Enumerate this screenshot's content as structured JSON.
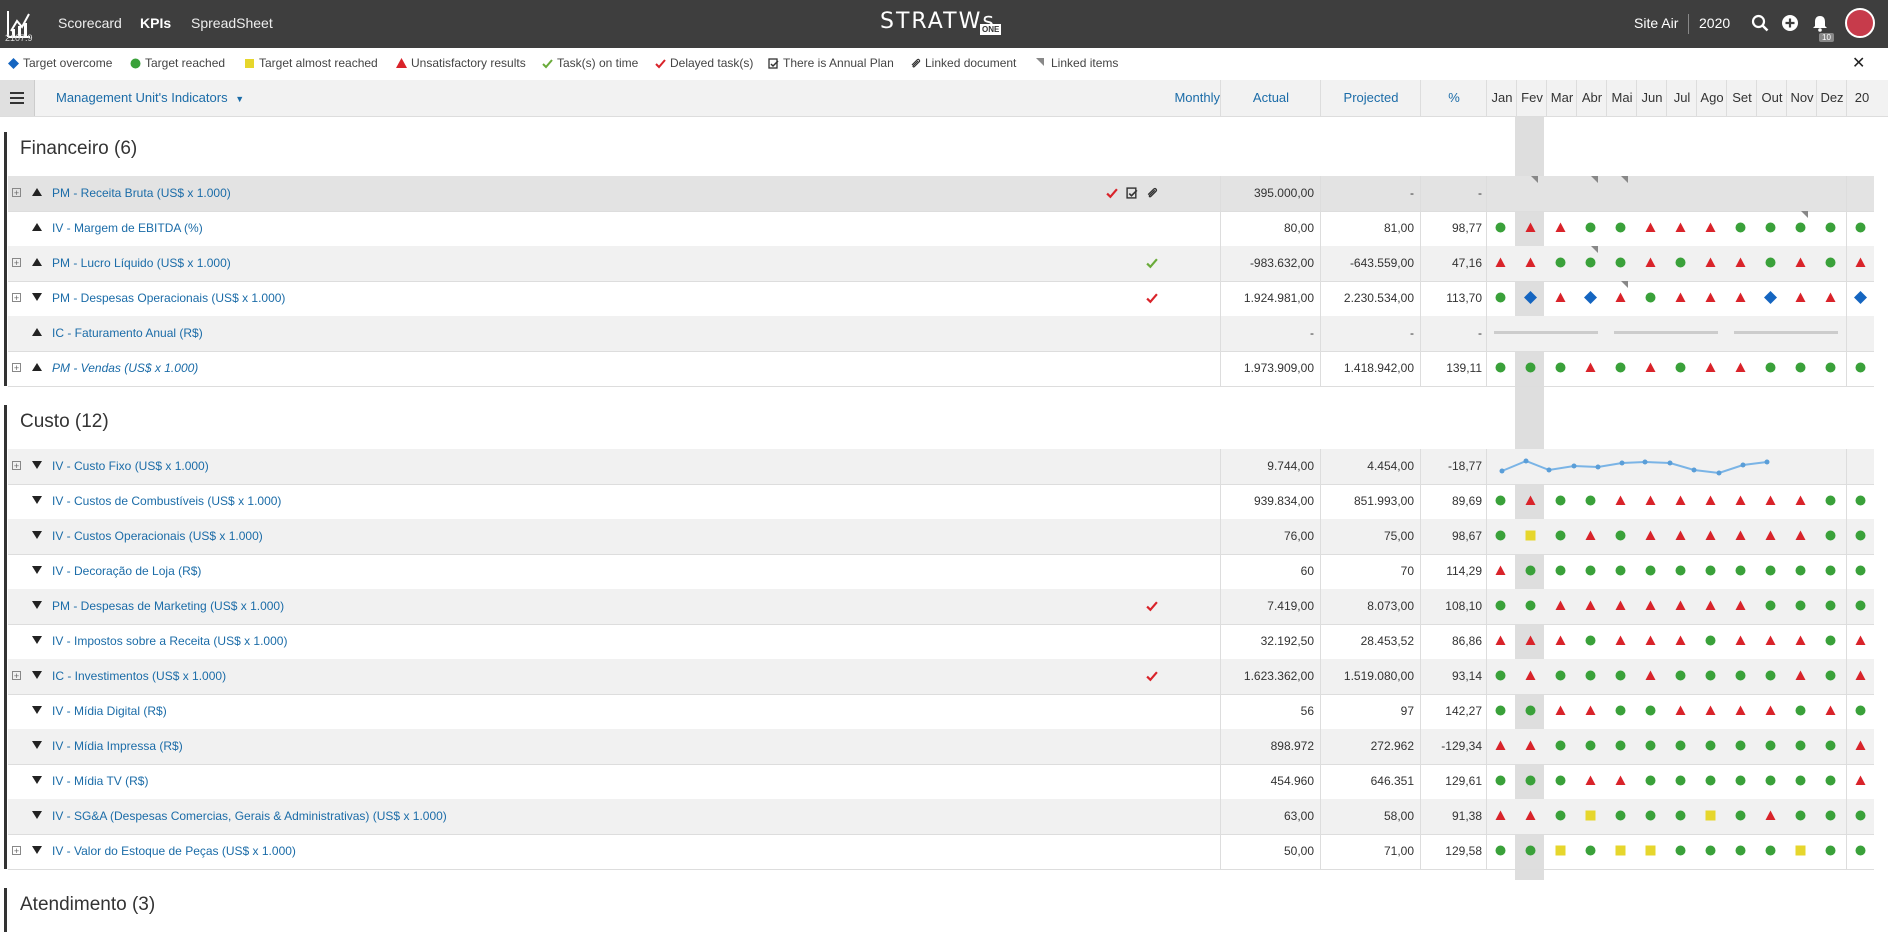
{
  "topbar": {
    "logo_number": "2107.9",
    "nav": [
      "Scorecard",
      "KPIs",
      "SpreadSheet"
    ],
    "active_nav": "KPIs",
    "brand": "STRATWs",
    "brand_sub": "ONE",
    "site": "Site Air",
    "year": "2020",
    "notification_count": "10"
  },
  "legend": [
    {
      "icon": "diamond",
      "color": "#1565c0",
      "label": "Target overcome"
    },
    {
      "icon": "circle",
      "color": "#3aa13a",
      "label": "Target reached"
    },
    {
      "icon": "square",
      "color": "#e6d62c",
      "label": "Target almost reached"
    },
    {
      "icon": "triangle",
      "color": "#d9232a",
      "label": "Unsatisfactory results"
    },
    {
      "icon": "check",
      "color": "#6aab3a",
      "label": "Task(s) on time"
    },
    {
      "icon": "check",
      "color": "#d9232a",
      "label": "Delayed task(s)"
    },
    {
      "icon": "plan",
      "color": "#333",
      "label": "There is Annual Plan"
    },
    {
      "icon": "clip",
      "color": "#333",
      "label": "Linked document"
    },
    {
      "icon": "corner",
      "color": "#888",
      "label": "Linked items"
    }
  ],
  "header": {
    "title": "Management Unit's Indicators",
    "frequency": "Monthly",
    "actual": "Actual",
    "projected": "Projected",
    "percent": "%",
    "months": [
      "Jan",
      "Fev",
      "Mar",
      "Abr",
      "Mai",
      "Jun",
      "Jul",
      "Ago",
      "Set",
      "Out",
      "Nov",
      "Dez",
      "20"
    ]
  },
  "colors": {
    "green": "#3aa13a",
    "red": "#d9232a",
    "blue": "#1565c0",
    "yellow": "#e6d62c",
    "link": "#1b6ca8"
  },
  "sections": [
    {
      "title": "Financeiro (6)",
      "rows": [
        {
          "name": "PM - Receita Bruta (US$ x 1.000)",
          "plus": true,
          "dir": "up",
          "flags": [
            "check-red",
            "plan",
            "clip"
          ],
          "actual": "395.000,00",
          "projected": "-",
          "pct": "-",
          "marks": "",
          "gray": true,
          "corners": [
            1,
            3,
            4
          ]
        },
        {
          "name": "IV - Margem de EBITDA (%)",
          "plus": false,
          "dir": "up",
          "flags": [],
          "actual": "80,00",
          "projected": "81,00",
          "pct": "98,77",
          "marks": "GRRGGRRRGGGGG",
          "corners": [
            10
          ]
        },
        {
          "name": "PM - Lucro Líquido (US$ x 1.000)",
          "plus": true,
          "dir": "up",
          "flags": [
            "check-green"
          ],
          "actual": "-983.632,00",
          "projected": "-643.559,00",
          "pct": "47,16",
          "marks": "RRGGGRGRRGRGR",
          "corners": [
            3
          ]
        },
        {
          "name": "PM - Despesas Operacionais (US$ x 1.000)",
          "plus": true,
          "dir": "down",
          "flags": [
            "check-red"
          ],
          "actual": "1.924.981,00",
          "projected": "2.230.534,00",
          "pct": "113,70",
          "marks": "GBRBRGRRRBRRB",
          "corners": [
            4
          ]
        },
        {
          "name": "IC - Faturamento Anual (R$)",
          "plus": false,
          "dir": "up",
          "flags": [],
          "actual": "-",
          "projected": "-",
          "pct": "-",
          "marks": "LINE",
          "corners": []
        },
        {
          "name": "PM - Vendas (US$ x 1.000)",
          "plus": true,
          "dir": "up",
          "flags": [],
          "actual": "1.973.909,00",
          "projected": "1.418.942,00",
          "pct": "139,11",
          "marks": "GGGRGRGRRGGGG",
          "italic": true,
          "corners": []
        }
      ]
    },
    {
      "title": "Custo (12)",
      "rows": [
        {
          "name": "IV - Custo Fixo (US$ x 1.000)",
          "plus": true,
          "dir": "down",
          "flags": [],
          "actual": "9.744,00",
          "projected": "4.454,00",
          "pct": "-18,77",
          "marks": "SPARK",
          "corners": []
        },
        {
          "name": "IV - Custos de Combustíveis (US$ x 1.000)",
          "plus": false,
          "dir": "down",
          "flags": [],
          "actual": "939.834,00",
          "projected": "851.993,00",
          "pct": "89,69",
          "marks": "GRGGRRRRRRRGG",
          "corners": []
        },
        {
          "name": "IV - Custos Operacionais (US$ x 1.000)",
          "plus": false,
          "dir": "down",
          "flags": [],
          "actual": "76,00",
          "projected": "75,00",
          "pct": "98,67",
          "marks": "GYGRGRRRRRRGG",
          "corners": []
        },
        {
          "name": "IV - Decoração de Loja (R$)",
          "plus": false,
          "dir": "down",
          "flags": [],
          "actual": "60",
          "projected": "70",
          "pct": "114,29",
          "marks": "RGGGGGGGGGGGG",
          "corners": []
        },
        {
          "name": "PM - Despesas de Marketing (US$ x 1.000)",
          "plus": false,
          "dir": "down",
          "flags": [
            "check-red"
          ],
          "actual": "7.419,00",
          "projected": "8.073,00",
          "pct": "108,10",
          "marks": "GGRRRRRRRGGGG",
          "corners": []
        },
        {
          "name": "IV - Impostos sobre a Receita (US$ x 1.000)",
          "plus": false,
          "dir": "down",
          "flags": [],
          "actual": "32.192,50",
          "projected": "28.453,52",
          "pct": "86,86",
          "marks": "RRRGRRRGRRRGR",
          "corners": []
        },
        {
          "name": "IC - Investimentos (US$ x 1.000)",
          "plus": true,
          "dir": "down",
          "flags": [
            "check-red"
          ],
          "actual": "1.623.362,00",
          "projected": "1.519.080,00",
          "pct": "93,14",
          "marks": "GRGGGRGGGGRGR",
          "corners": []
        },
        {
          "name": "IV - Mídia Digital (R$)",
          "plus": false,
          "dir": "down",
          "flags": [],
          "actual": "56",
          "projected": "97",
          "pct": "142,27",
          "marks": "GGRRGGRRRRGRG",
          "corners": []
        },
        {
          "name": "IV - Mídia Impressa (R$)",
          "plus": false,
          "dir": "down",
          "flags": [],
          "actual": "898.972",
          "projected": "272.962",
          "pct": "-129,34",
          "marks": "RRGGGGGGGGGGR",
          "corners": []
        },
        {
          "name": "IV - Mídia TV (R$)",
          "plus": false,
          "dir": "down",
          "flags": [],
          "actual": "454.960",
          "projected": "646.351",
          "pct": "129,61",
          "marks": "GGGRRGGGGGGGR",
          "corners": []
        },
        {
          "name": "IV - SG&A (Despesas Comercias, Gerais & Administrativas) (US$ x 1.000)",
          "plus": false,
          "dir": "down",
          "flags": [],
          "actual": "63,00",
          "projected": "58,00",
          "pct": "91,38",
          "marks": "RRGYGGGYGRGGG",
          "corners": []
        },
        {
          "name": "IV - Valor do Estoque de Peças (US$ x 1.000)",
          "plus": true,
          "dir": "down",
          "flags": [],
          "actual": "50,00",
          "projected": "71,00",
          "pct": "129,58",
          "marks": "GGYGYYGGGGYGG",
          "corners": []
        }
      ]
    },
    {
      "title": "Atendimento (3)",
      "rows": []
    }
  ]
}
